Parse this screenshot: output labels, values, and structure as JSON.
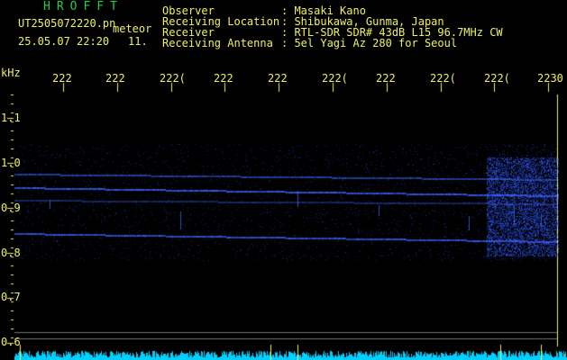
{
  "header": {
    "logo": "HROFFT",
    "filename": "UT2505072220.pn",
    "tag": "meteor",
    "datetime": "25.05.07 22:20",
    "count": "11.",
    "rows": [
      {
        "label": "Observer",
        "value": ": Masaki Kano"
      },
      {
        "label": "Receiving Location",
        "value": ": Shibukawa, Gunma, Japan"
      },
      {
        "label": "Receiver",
        "value": ": RTL-SDR SDR# 43dB L15 96.7MHz CW"
      },
      {
        "label": "Receiving Antenna",
        "value": ": 5el Yagi Az 280 for Seoul"
      }
    ]
  },
  "axis": {
    "unit": "kHz",
    "time_ticks": [
      "222",
      "222",
      "222(",
      "222",
      "222",
      "222(",
      "222",
      "222(",
      "222(",
      "2230"
    ],
    "freq_ticks": [
      "1.1",
      "1.0",
      "0.9",
      "0.8",
      "0.7",
      "0.6"
    ]
  },
  "colors": {
    "text": "#f0f060",
    "logo": "#20d040",
    "signal": "#3050ff",
    "baseline": "#00d0ff"
  }
}
